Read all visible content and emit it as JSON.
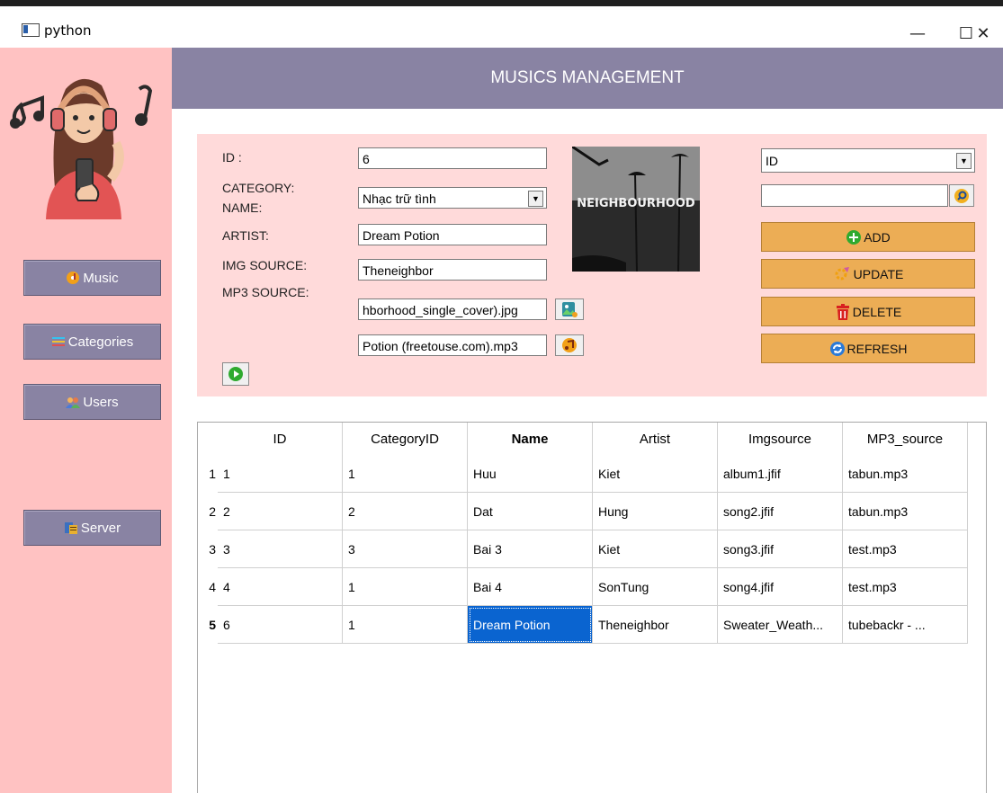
{
  "window": {
    "title": "python",
    "min": "—",
    "max": "☐",
    "close": "✕"
  },
  "header": {
    "title": "MUSICS MANAGEMENT"
  },
  "sidebar": {
    "items": [
      {
        "label": "Music",
        "icon": "music-disc-icon"
      },
      {
        "label": "Categories",
        "icon": "list-icon"
      },
      {
        "label": "Users",
        "icon": "users-icon"
      },
      {
        "label": "Server",
        "icon": "database-icon"
      }
    ]
  },
  "form": {
    "id_label": "ID :",
    "category_label": "CATEGORY:",
    "name_label": "NAME:",
    "artist_label": "ARTIST:",
    "img_label": "IMG SOURCE:",
    "mp3_label": "MP3 SOURCE:",
    "id_value": "6",
    "category_value": "Nhạc trữ tình",
    "name_value": "Dream Potion",
    "artist_value": "Theneighbor",
    "img_value": "hborhood_single_cover).jpg",
    "mp3_value": "Potion (freetouse.com).mp3",
    "cover_text": "NEIGHBOURHOOD"
  },
  "search": {
    "field_value": "ID",
    "query": ""
  },
  "actions": {
    "add": "ADD",
    "update": "UPDATE",
    "delete": "DELETE",
    "refresh": "REFRESH"
  },
  "table": {
    "columns": [
      "ID",
      "CategoryID",
      "Name",
      "Artist",
      "Imgsource",
      "MP3_source"
    ],
    "rows": [
      {
        "num": "1",
        "cells": [
          "1",
          "1",
          "Huu",
          "Kiet",
          "album1.jfif",
          "tabun.mp3"
        ]
      },
      {
        "num": "2",
        "cells": [
          "2",
          "2",
          "Dat",
          "Hung",
          "song2.jfif",
          "tabun.mp3"
        ]
      },
      {
        "num": "3",
        "cells": [
          "3",
          "3",
          "Bai 3",
          "Kiet",
          "song3.jfif",
          "test.mp3"
        ]
      },
      {
        "num": "4",
        "cells": [
          "4",
          "1",
          "Bai 4",
          "SonTung",
          "song4.jfif",
          "test.mp3"
        ]
      },
      {
        "num": "5",
        "cells": [
          "6",
          "1",
          "Dream Potion",
          "Theneighbor",
          "Sweater_Weath...",
          "tubebackr - ..."
        ]
      }
    ]
  },
  "colors": {
    "sidebar": "#ffc2c2",
    "header": "#8983a3",
    "panel": "#ffdada",
    "action": "#ecad55",
    "selection": "#0a64d0"
  }
}
